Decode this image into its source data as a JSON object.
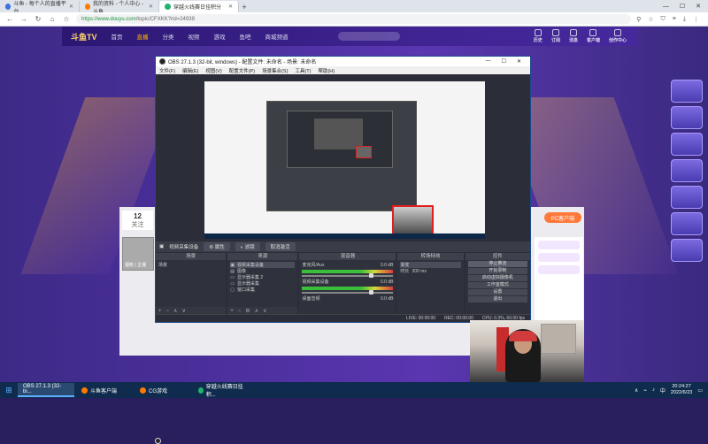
{
  "browser": {
    "tabs": [
      {
        "label": "斗鱼 - 每个人的直播平台",
        "icon": "douyu-icon"
      },
      {
        "label": "我的资料 - 个人中心 - 斗鱼",
        "icon": "douyu-icon"
      },
      {
        "label": "穿越火线赛日挂积分",
        "icon": "douyu-icon"
      }
    ],
    "url_host": "https://www.douyu.com",
    "url_path": "/topic/CFXKK?rid=24939"
  },
  "site": {
    "logo": "斗鱼TV",
    "nav": [
      "首页",
      "直播",
      "分类",
      "视频",
      "游戏",
      "鱼吧",
      "商城频道"
    ],
    "active_nav": "直播",
    "header_right": [
      "历史",
      "订阅",
      "消息",
      "客户端",
      "创作中心"
    ],
    "room_count": "12",
    "room_label": "关注",
    "avatar_label": "烟枪 | 主播",
    "gift_button": "PC客户端"
  },
  "obs": {
    "title": "OBS 27.1.3 (32-bit, windows) - 配置文件: 未命名 - 场景: 未命名",
    "menu": [
      "文件(F)",
      "编辑(E)",
      "视图(V)",
      "配置文件(P)",
      "场景集合(S)",
      "工具(T)",
      "帮助(H)"
    ],
    "toolbar_source": "视频采集设备",
    "toolbar_props": "属性",
    "toolbar_filters": "滤镜",
    "toolbar_deactivate": "取消激活",
    "docks": {
      "scenes": {
        "title": "场景",
        "items": [
          "场景"
        ]
      },
      "sources": {
        "title": "来源",
        "items": [
          "视频采集设备",
          "图像",
          "显示器采集 2",
          "显示器采集",
          "窗口采集"
        ]
      },
      "mixer": {
        "title": "混音器",
        "channels": [
          {
            "name": "麦克风/Aux",
            "db": "0.0 dB"
          },
          {
            "name": "视频采集设备",
            "db": "0.0 dB"
          },
          {
            "name": "桌面音频",
            "db": "0.0 dB"
          }
        ]
      },
      "transitions": {
        "title": "转场特效",
        "type": "渐变",
        "duration_label": "时长",
        "duration": "300 ms"
      },
      "controls": {
        "title": "控件",
        "buttons": [
          "停止推流",
          "开始录制",
          "启动虚拟摄像机",
          "工作室模式",
          "设置",
          "退出"
        ]
      }
    },
    "status": {
      "live": "LIVE: 00:00:00",
      "rec": "REC: 00:00:00",
      "cpu": "CPU: 0.3%, 60.00 fps"
    }
  },
  "taskbar": {
    "items": [
      {
        "label": "OBS 27.1.3 (32-bi...",
        "icon": "obs-icon"
      },
      {
        "label": "斗鱼客户端",
        "icon": "douyu-icon"
      },
      {
        "label": "CG游戏",
        "icon": "game-icon"
      },
      {
        "label": "穿越火线赛日挂积...",
        "icon": "browser-icon"
      }
    ],
    "time": "20:24:27",
    "date": "2022/6/23"
  }
}
